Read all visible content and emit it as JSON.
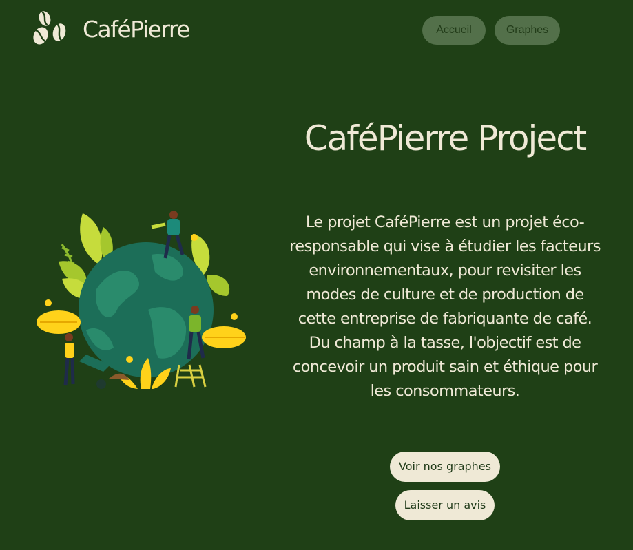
{
  "header": {
    "brand": "CaféPierre",
    "logo_icon": "coffee-beans-icon",
    "nav": [
      {
        "label": "Accueil"
      },
      {
        "label": "Graphes"
      }
    ]
  },
  "main": {
    "title": "CaféPierre Project",
    "paragraph_1": "Le projet CaféPierre est un projet éco-responsable qui vise à étudier les facteurs environnementaux, pour revisiter les modes de culture et de production de cette entreprise de fabriquante de café.",
    "paragraph_2": "Du champ à la tasse, l'objectif est de concevoir un produit sain et éthique pour les consommateurs.",
    "buttons": {
      "graphs": "Voir nos graphes",
      "review": "Laisser un avis"
    }
  },
  "colors": {
    "background": "#1f4016",
    "text": "#efe9d6",
    "nav_button": "#53704a",
    "cta_background": "#efe9d6"
  }
}
